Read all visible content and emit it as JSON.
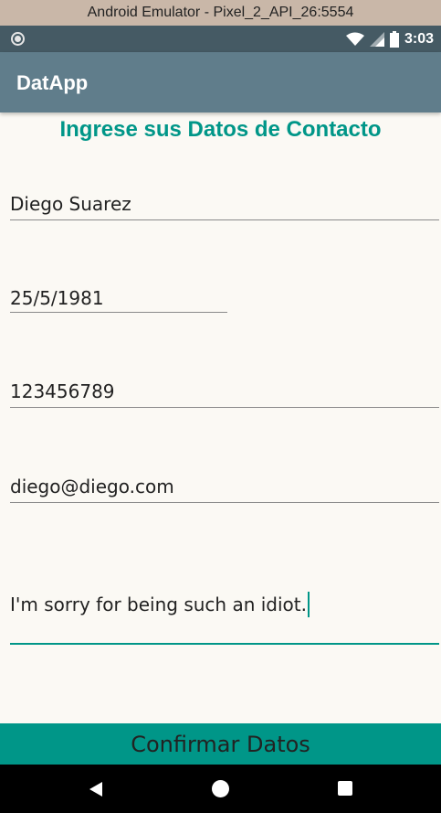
{
  "window": {
    "title": "Android Emulator - Pixel_2_API_26:5554"
  },
  "status_bar": {
    "time": "3:03",
    "icons": [
      "notification-dot-icon",
      "wifi-icon",
      "signal-icon",
      "battery-icon"
    ]
  },
  "app_bar": {
    "title": "DatApp"
  },
  "form": {
    "header": "Ingrese sus Datos de Contacto",
    "fields": [
      {
        "value": "Diego Suarez"
      },
      {
        "value": "25/5/1981"
      },
      {
        "value": "123456789"
      },
      {
        "value": "diego@diego.com"
      },
      {
        "value": "I'm sorry for being such an idiot."
      }
    ],
    "confirm_label": "Confirmar Datos"
  },
  "nav_bar": {
    "icons": [
      "back-icon",
      "home-icon",
      "recent-apps-icon"
    ]
  },
  "colors": {
    "accent": "#009688",
    "app_bar": "#607d8b",
    "status_bar": "#455a64",
    "background": "#fbf9f4"
  }
}
